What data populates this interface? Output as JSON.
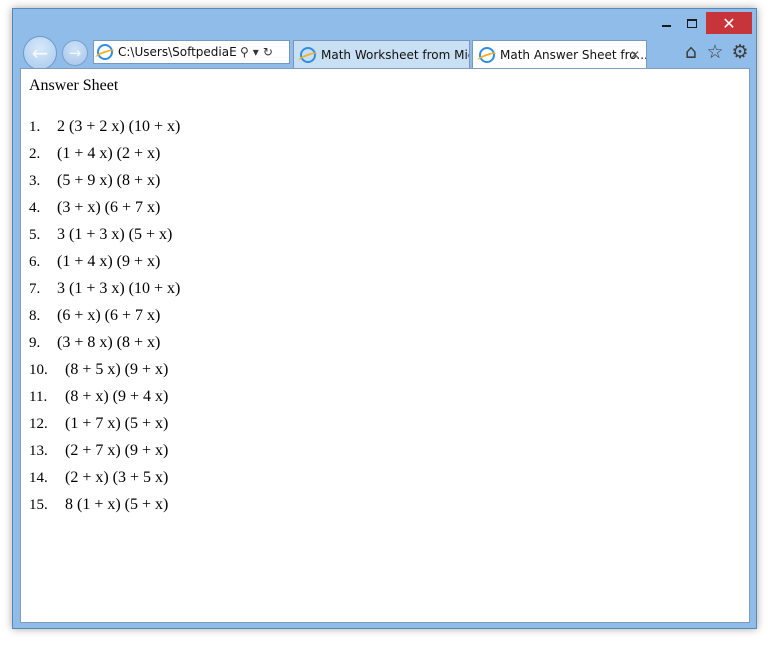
{
  "window": {
    "controls": {
      "minimize": "minimize",
      "maximize": "maximize",
      "close": "✕"
    }
  },
  "address_bar": {
    "url": "C:\\Users\\SoftpediaEdit"
  },
  "tabs": [
    {
      "label": "Math Worksheet from Mic...",
      "active": false
    },
    {
      "label": "Math Answer Sheet fro...",
      "active": true,
      "close": "✕"
    }
  ],
  "toolbar": {
    "icons": [
      "home-icon",
      "star-icon",
      "gear-icon"
    ]
  },
  "page": {
    "title": "Answer Sheet",
    "answers": [
      {
        "num": "1.",
        "expr": "2 (3 + 2 x) (10 + x)"
      },
      {
        "num": "2.",
        "expr": "(1 + 4 x) (2 + x)"
      },
      {
        "num": "3.",
        "expr": "(5 + 9 x) (8 + x)"
      },
      {
        "num": "4.",
        "expr": "(3 + x) (6 + 7 x)"
      },
      {
        "num": "5.",
        "expr": "3 (1 + 3 x) (5 + x)"
      },
      {
        "num": "6.",
        "expr": "(1 + 4 x) (9 + x)"
      },
      {
        "num": "7.",
        "expr": "3 (1 + 3 x) (10 + x)"
      },
      {
        "num": "8.",
        "expr": "(6 + x) (6 + 7 x)"
      },
      {
        "num": "9.",
        "expr": "(3 + 8 x) (8 + x)"
      },
      {
        "num": "10.",
        "expr": "(8 + 5 x) (9 + x)"
      },
      {
        "num": "11.",
        "expr": "(8 + x) (9 + 4 x)"
      },
      {
        "num": "12.",
        "expr": "(1 + 7 x) (5 + x)"
      },
      {
        "num": "13.",
        "expr": "(2 + 7 x) (9 + x)"
      },
      {
        "num": "14.",
        "expr": "(2 + x) (3 + 5 x)"
      },
      {
        "num": "15.",
        "expr": "8 (1 + x) (5 + x)"
      }
    ]
  },
  "colors": {
    "frame": "#8fbce8",
    "close_button": "#c7343a",
    "active_tab": "#ffffff",
    "inactive_tab": "#c9dff3"
  }
}
